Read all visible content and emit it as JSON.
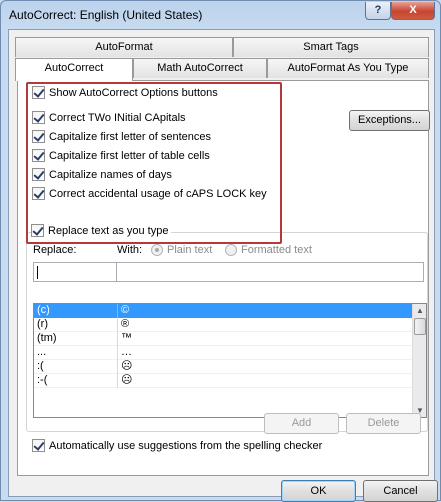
{
  "window": {
    "title": "AutoCorrect: English (United States)",
    "help_glyph": "?",
    "close_glyph": "X"
  },
  "tabs": {
    "autoformat": "AutoFormat",
    "smart_tags": "Smart Tags",
    "autocorrect": "AutoCorrect",
    "math_autocorrect": "Math AutoCorrect",
    "autoformat_as_you_type": "AutoFormat As You Type"
  },
  "options": {
    "show_buttons": "Show AutoCorrect Options buttons",
    "two_initial_caps": "Correct TWo INitial CApitals",
    "cap_first_sentence": "Capitalize first letter of sentences",
    "cap_first_table": "Capitalize first letter of table cells",
    "cap_days": "Capitalize names of days",
    "caps_lock": "Correct accidental usage of cAPS LOCK key",
    "exceptions_button": "Exceptions..."
  },
  "replace_section": {
    "replace_as_you_type": "Replace text as you type",
    "replace_label": "Replace:",
    "with_label": "With:",
    "plain_text": "Plain text",
    "formatted_text": "Formatted text",
    "replace_value": "",
    "with_value": ""
  },
  "entries": [
    {
      "replace": "(c)",
      "with": "©"
    },
    {
      "replace": "(r)",
      "with": "®"
    },
    {
      "replace": "(tm)",
      "with": "™"
    },
    {
      "replace": "...",
      "with": "…"
    },
    {
      "replace": ":(",
      "with": "☹"
    },
    {
      "replace": ":-(",
      "with": "☹"
    }
  ],
  "buttons": {
    "add": "Add",
    "delete": "Delete",
    "ok": "OK",
    "cancel": "Cancel"
  },
  "spelling_suggestions": "Automatically use suggestions from the spelling checker",
  "icons": [
    "help-icon",
    "close-icon",
    "checkbox-checked-icon",
    "scroll-up-icon",
    "scroll-down-icon"
  ]
}
